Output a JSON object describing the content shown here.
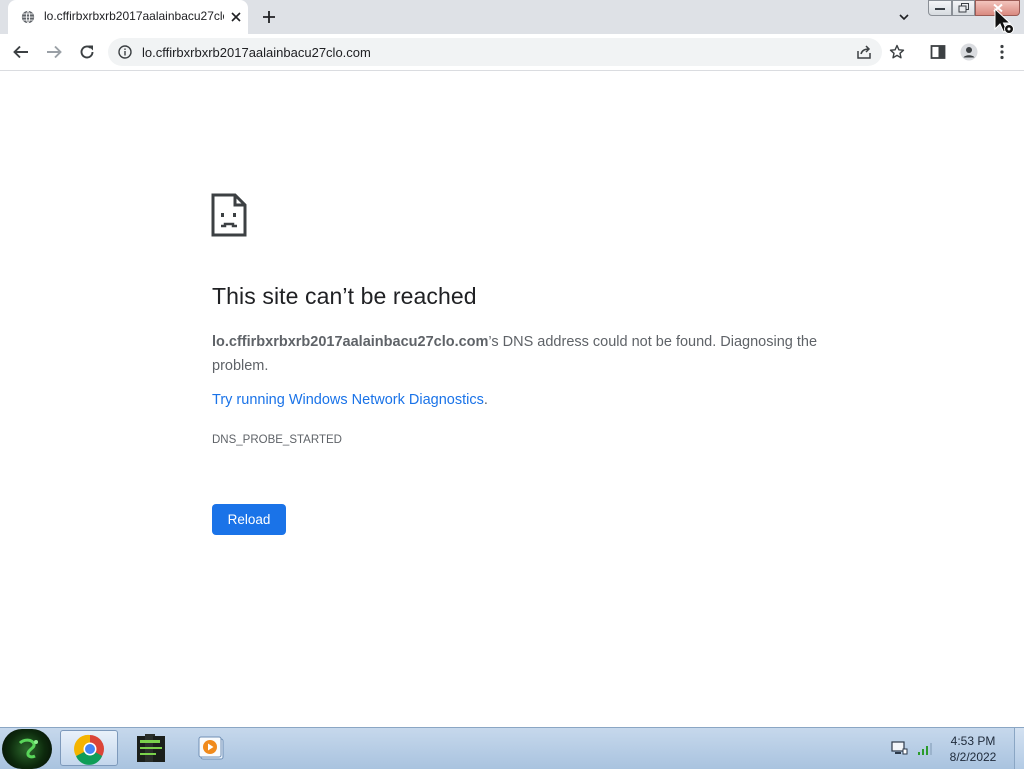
{
  "browser": {
    "tab": {
      "title": "lo.cffirbxrbxrb2017aalainbacu27clo.com"
    },
    "address_bar": {
      "url": "lo.cffirbxrbxrb2017aalainbacu27clo.com"
    }
  },
  "error_page": {
    "heading": "This site can’t be reached",
    "host": "lo.cffirbxrbxrb2017aalainbacu27clo.com",
    "message": "’s DNS address could not be found. Diagnosing the problem.",
    "link_text": "Try running Windows Network Diagnostics",
    "link_suffix": ".",
    "error_code": "DNS_PROBE_STARTED",
    "reload_label": "Reload"
  },
  "taskbar": {
    "apps": [
      {
        "name": "Google Chrome",
        "active": true
      },
      {
        "name": "Terminal",
        "active": false
      },
      {
        "name": "Media Player",
        "active": false
      }
    ],
    "clock": {
      "time": "4:53 PM",
      "date": "8/2/2022"
    }
  },
  "colors": {
    "link": "#1a73e8",
    "button": "#1a73e8",
    "heading": "#202124",
    "body_text": "#5f6368",
    "tab_strip": "#dee1e6"
  }
}
